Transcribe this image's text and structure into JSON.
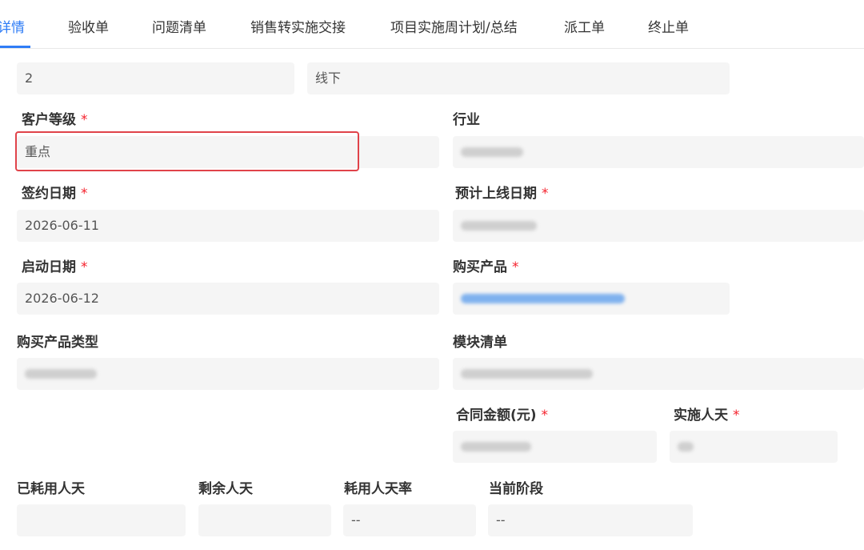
{
  "tabs": [
    {
      "label": "详情",
      "active": true
    },
    {
      "label": "验收单"
    },
    {
      "label": "问题清单"
    },
    {
      "label": "销售转实施交接"
    },
    {
      "label": "项目实施周计划/总结"
    },
    {
      "label": "派工单"
    },
    {
      "label": "终止单"
    }
  ],
  "top_row": {
    "field1_value": "2",
    "field2_value": "线下"
  },
  "fields": {
    "customer_level": {
      "label": "客户等级",
      "value": "重点"
    },
    "industry": {
      "label": "行业"
    },
    "sign_date": {
      "label": "签约日期",
      "value": "2026-06-11"
    },
    "expected_online_date": {
      "label": "预计上线日期"
    },
    "start_date": {
      "label": "启动日期",
      "value": "2026-06-12"
    },
    "purchased_product": {
      "label": "购买产品"
    },
    "purchased_product_type": {
      "label": "购买产品类型"
    },
    "module_list": {
      "label": "模块清单"
    },
    "contract_amount": {
      "label": "合同金额(元)"
    },
    "implementation_person_days": {
      "label": "实施人天"
    },
    "used_person_days": {
      "label": "已耗用人天",
      "value": ""
    },
    "remaining_person_days": {
      "label": "剩余人天",
      "value": ""
    },
    "used_person_days_rate": {
      "label": "耗用人天率",
      "value": "--"
    },
    "current_stage": {
      "label": "当前阶段",
      "value": "--"
    }
  },
  "required_mark": "*",
  "colors": {
    "accent": "#2f7df6",
    "required": "#f5222d",
    "highlight_border": "#e0434a",
    "field_bg": "#f5f5f5"
  }
}
